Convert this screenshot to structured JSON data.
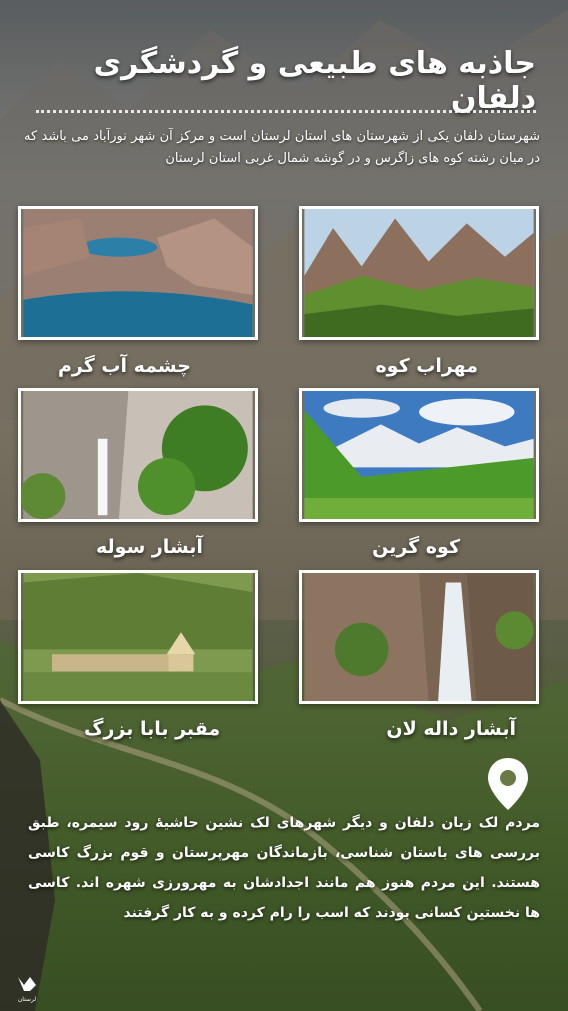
{
  "title": "جاذبه های طبیعی و گردشگری دلفان",
  "intro": "شهرستان دلفان یکی از شهرستان های استان لرستان است و مرکز آن شهر نورآباد می باشد که در میان رشته کوه های زاگرس و در گوشه شمال غربی استان لرستان",
  "attractions": [
    {
      "label": "مهراب کوه",
      "icon": "mountain-photo"
    },
    {
      "label": "چشمه آب گرم",
      "icon": "lake-photo"
    },
    {
      "label": "کوه گرین",
      "icon": "snowy-mountain-photo"
    },
    {
      "label": "آبشار سوله",
      "icon": "waterfall-photo"
    },
    {
      "label": "آبشار داله لان",
      "icon": "canyon-waterfall-photo"
    },
    {
      "label": "مقبر بابا بزرگ",
      "icon": "shrine-photo"
    }
  ],
  "paragraph": "مردم لک زبان دلفان و دیگر شهرهای لک نشین حاشیهٔ رود سیمره، طبق بررسی های باستان شناسی، بازماندگان مهرپرستان و قوم بزرگ کاسی هستند. این مردم هنوز هم مانند اجدادشان به مهرورزی شهره اند. کاسی ها نخستین کسانی بودند که اسب را رام کرده و به کار گرفتند",
  "logo_text": "لرستان",
  "colors": {
    "text": "#ffffff",
    "frame": "#ffffff"
  }
}
